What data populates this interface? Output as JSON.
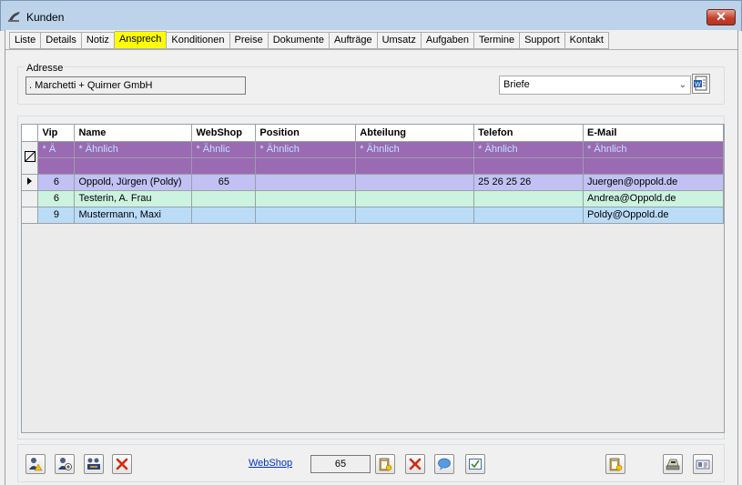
{
  "window": {
    "title": "Kunden",
    "close_label": "✕"
  },
  "tabs": [
    {
      "label": "Liste"
    },
    {
      "label": "Details"
    },
    {
      "label": "Notiz"
    },
    {
      "label": "Ansprech"
    },
    {
      "label": "Konditionen"
    },
    {
      "label": "Preise"
    },
    {
      "label": "Dokumente"
    },
    {
      "label": "Aufträge"
    },
    {
      "label": "Umsatz"
    },
    {
      "label": "Aufgaben"
    },
    {
      "label": "Termine"
    },
    {
      "label": "Support"
    },
    {
      "label": "Kontakt"
    }
  ],
  "active_tab": "Ansprech",
  "address": {
    "label": "Adresse",
    "value": ". Marchetti + Quirner GmbH"
  },
  "letters_select": {
    "value": "Briefe"
  },
  "grid": {
    "columns": [
      "Vip",
      "Name",
      "WebShop",
      "Position",
      "Abteilung",
      "Telefon",
      "E-Mail"
    ],
    "filter_row": [
      "* Ä",
      "* Ähnlich",
      "* Ähnlic",
      "* Ähnlich",
      "* Ähnlich",
      "* Ähnlich",
      "* Ähnlich"
    ],
    "rows": [
      {
        "vip": "6",
        "name": "Oppold, Jürgen (Poldy)",
        "webshop": "65",
        "position": "",
        "abteilung": "",
        "telefon": "25 26 25 26",
        "email": "Juergen@oppold.de"
      },
      {
        "vip": "6",
        "name": "Testerin, A. Frau",
        "webshop": "",
        "position": "",
        "abteilung": "",
        "telefon": "",
        "email": "Andrea@Oppold.de"
      },
      {
        "vip": "9",
        "name": "Mustermann, Maxi",
        "webshop": "",
        "position": "",
        "abteilung": "",
        "telefon": "",
        "email": "Poldy@Oppold.de"
      }
    ]
  },
  "bottom": {
    "webshop_link": "WebShop",
    "webshop_count": "65"
  },
  "colors": {
    "filter_row": "#9a6ab2",
    "row_selected": "#c1c1f3",
    "row_alt1": "#ccf2e0",
    "row_alt2": "#bbdcf6",
    "active_tab": "#ffff00"
  }
}
